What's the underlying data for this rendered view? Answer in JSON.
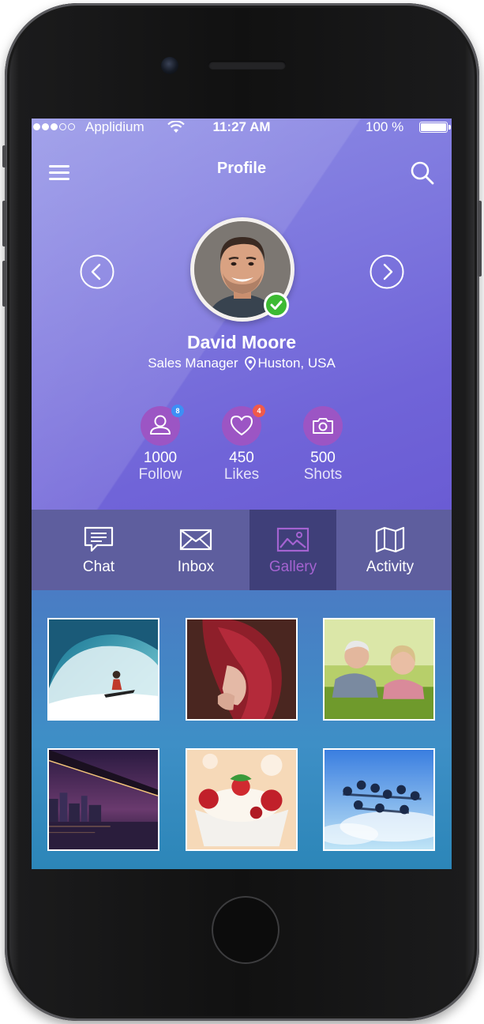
{
  "status": {
    "carrier": "Applidium",
    "time": "11:27 AM",
    "battery_percent": "100 %",
    "battery_level": 1.0,
    "signal_bars": 3,
    "signal_total": 5
  },
  "header": {
    "title": "Profile",
    "menu_icon": "hamburger-icon",
    "search_icon": "search-icon"
  },
  "profile": {
    "name": "David Moore",
    "role": "Sales Manager",
    "location": "Huston, USA"
  },
  "stats": [
    {
      "value": "1000",
      "label": "Follow",
      "badge": "8",
      "badge_color": "#3d8ff5",
      "icon": "user-icon"
    },
    {
      "value": "450",
      "label": "Likes",
      "badge": "4",
      "badge_color": "#f05a4a",
      "icon": "heart-icon"
    },
    {
      "value": "500",
      "label": "Shots",
      "badge": "",
      "icon": "camera-icon"
    }
  ],
  "tabs": [
    {
      "label": "Chat",
      "icon": "chat-icon"
    },
    {
      "label": "Inbox",
      "icon": "envelope-icon"
    },
    {
      "label": "Gallery",
      "icon": "image-icon",
      "active": true
    },
    {
      "label": "Activity",
      "icon": "map-icon"
    }
  ],
  "gallery": [
    {
      "subject": "surfer-photo"
    },
    {
      "subject": "red-hair-woman-photo"
    },
    {
      "subject": "elderly-couple-photo"
    },
    {
      "subject": "city-bridge-night-photo"
    },
    {
      "subject": "ice-cream-dessert-photo"
    },
    {
      "subject": "skydivers-photo"
    }
  ],
  "colors": {
    "accent": "#a463d1",
    "badge_blue": "#3d8ff5",
    "badge_red": "#f05a4a",
    "verified": "#3cba33"
  }
}
